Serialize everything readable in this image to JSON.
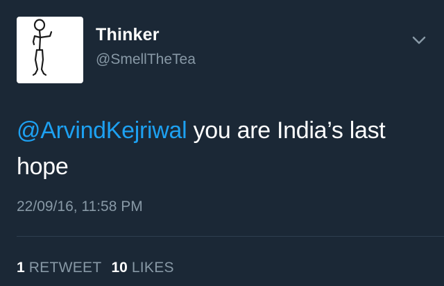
{
  "user": {
    "display_name": "Thinker",
    "username": "@SmellTheTea",
    "avatar_icon": "stick-figure-icon"
  },
  "tweet": {
    "mention": "@ArvindKejriwal",
    "text": " you are India’s last hope",
    "timestamp": "22/09/16, 11:58 PM"
  },
  "stats": {
    "retweets_count": "1",
    "retweets_label": "RETWEET",
    "likes_count": "10",
    "likes_label": "LIKES"
  },
  "colors": {
    "background": "#1b2836",
    "mention": "#1da1f2",
    "muted": "#8899a6",
    "text": "#ffffff"
  }
}
